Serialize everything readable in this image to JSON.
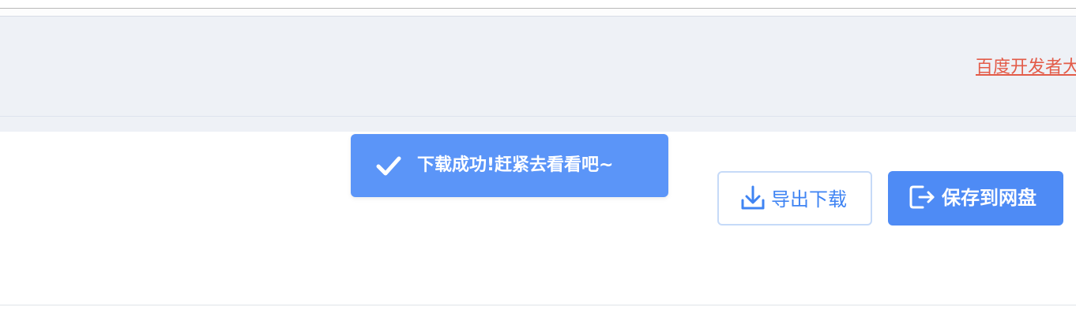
{
  "header": {
    "link_text": "百度开发者大"
  },
  "toast": {
    "message": "下载成功!赶紧去看看吧~",
    "icon": "check-icon",
    "color": "#5b95f8"
  },
  "actions": {
    "export_label": "导出下载",
    "export_icon": "download-icon",
    "save_label": "保存到网盘",
    "save_icon": "export-to-cloud-icon",
    "primary_color": "#4e8bf5",
    "link_color": "#e35b48"
  }
}
